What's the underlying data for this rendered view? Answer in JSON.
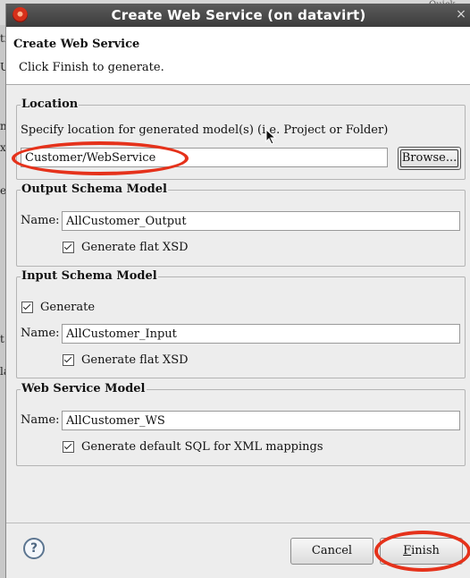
{
  "background": {
    "quick_access": "Quick",
    "fragments": [
      "tir",
      "Uı",
      "n",
      "xı",
      "ex",
      "t",
      "la"
    ]
  },
  "dialog": {
    "title": "Create Web Service  (on datavirt)",
    "close_glyph": "×"
  },
  "header": {
    "title": "Create Web Service",
    "message": "Click Finish to generate."
  },
  "location": {
    "group_title": "Location",
    "description": "Specify location for generated model(s) (i.e. Project or Folder)",
    "value": "Customer/WebService",
    "browse_label": "Browse..."
  },
  "output_schema": {
    "group_title": "Output Schema Model",
    "name_label": "Name:",
    "name_value": "AllCustomer_Output",
    "flat_xsd_label": "Generate flat XSD",
    "flat_xsd_checked": true
  },
  "input_schema": {
    "group_title": "Input Schema Model",
    "generate_label": "Generate",
    "generate_checked": true,
    "name_label": "Name:",
    "name_value": "AllCustomer_Input",
    "flat_xsd_label": "Generate flat XSD",
    "flat_xsd_checked": true
  },
  "web_service": {
    "group_title": "Web Service Model",
    "name_label": "Name:",
    "name_value": "AllCustomer_WS",
    "default_sql_label": "Generate default SQL for XML mappings",
    "default_sql_checked": true
  },
  "footer": {
    "help_glyph": "?",
    "cancel_label": "Cancel",
    "finish_first": "F",
    "finish_rest": "inish"
  },
  "colors": {
    "annotation_red": "#e5321b",
    "titlebar": "#4a4a4a",
    "dialog_bg": "#ededed"
  }
}
